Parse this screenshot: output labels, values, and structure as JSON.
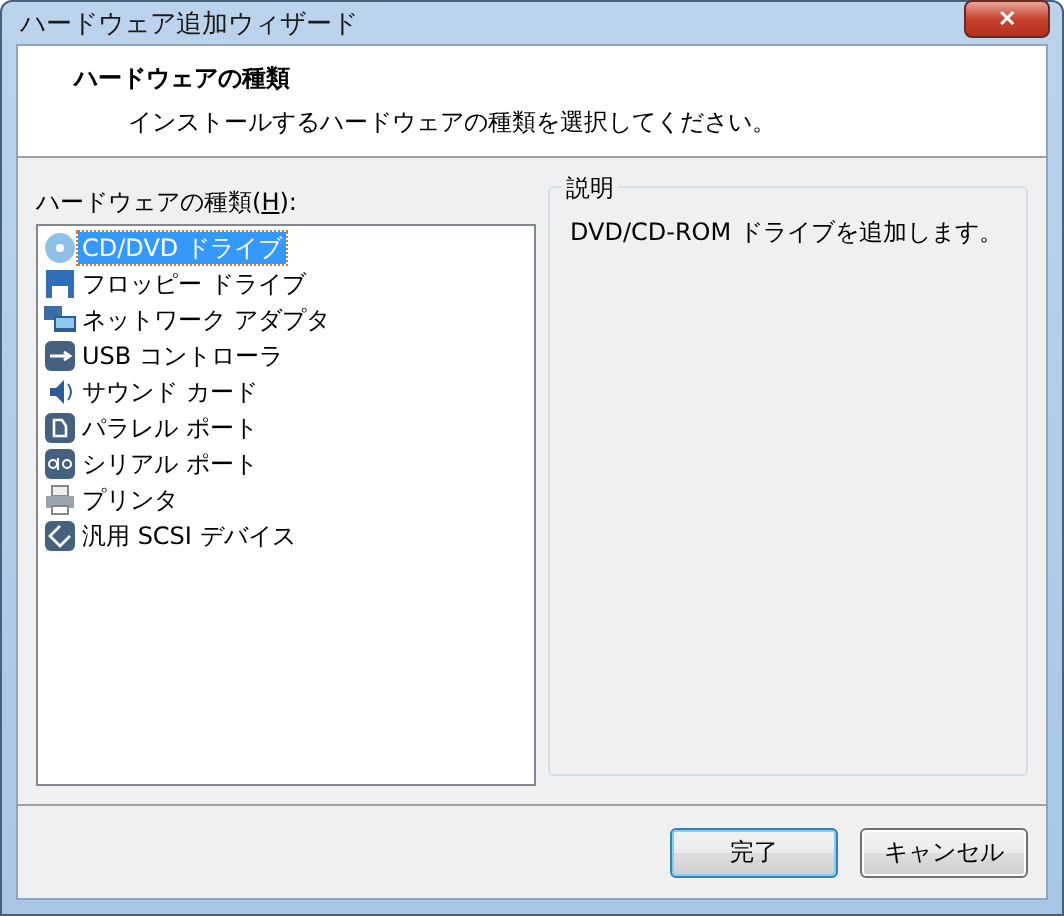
{
  "window": {
    "title": "ハードウェア追加ウィザード",
    "close": "✕"
  },
  "header": {
    "title": "ハードウェアの種類",
    "subtitle": "インストールするハードウェアの種類を選択してください。"
  },
  "list_label": {
    "before": "ハードウェアの種類(",
    "access_key": "H",
    "after": "):"
  },
  "items": [
    {
      "label": "CD/DVD ドライブ",
      "kind": "disc",
      "selected": true
    },
    {
      "label": "フロッピー ドライブ",
      "kind": "floppy",
      "selected": false
    },
    {
      "label": "ネットワーク アダプタ",
      "kind": "network",
      "selected": false
    },
    {
      "label": "USB コントローラ",
      "kind": "usb",
      "selected": false
    },
    {
      "label": "サウンド カード",
      "kind": "sound",
      "selected": false
    },
    {
      "label": "パラレル ポート",
      "kind": "parallel",
      "selected": false
    },
    {
      "label": "シリアル ポート",
      "kind": "serial",
      "selected": false
    },
    {
      "label": "プリンタ",
      "kind": "printer",
      "selected": false
    },
    {
      "label": "汎用 SCSI デバイス",
      "kind": "scsi",
      "selected": false
    }
  ],
  "description": {
    "title": "説明",
    "text": "DVD/CD-ROM ドライブを追加します。"
  },
  "buttons": [
    {
      "label": "完了",
      "default": true
    },
    {
      "label": "キャンセル",
      "default": false
    }
  ]
}
